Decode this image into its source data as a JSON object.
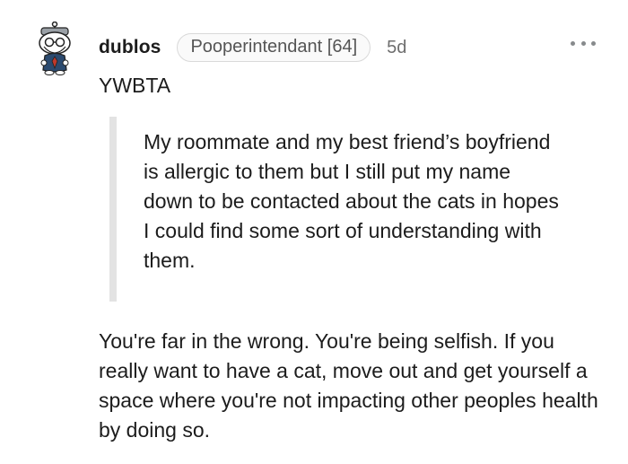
{
  "comment": {
    "username": "dublos",
    "flair": "Pooperintendant [64]",
    "age": "5d",
    "more_icon": "more-dots-icon",
    "avatar_icon": "snoo-avatar-icon",
    "top_text": "YWBTA",
    "quote": "My roommate and my best friend’s boyfriend is allergic to them but I still put my name down to be contacted about the cats in hopes I could find some sort of understanding with them.",
    "reply": "You're far in the wrong. You're being selfish. If you really want to have a cat, move out and get yourself a space where you're not impacting other peoples health by doing so."
  },
  "colors": {
    "text": "#1c1c1c",
    "muted": "#6e6e6e",
    "flair_border": "#d9d9d9",
    "quote_bar": "#e3e3e3"
  }
}
